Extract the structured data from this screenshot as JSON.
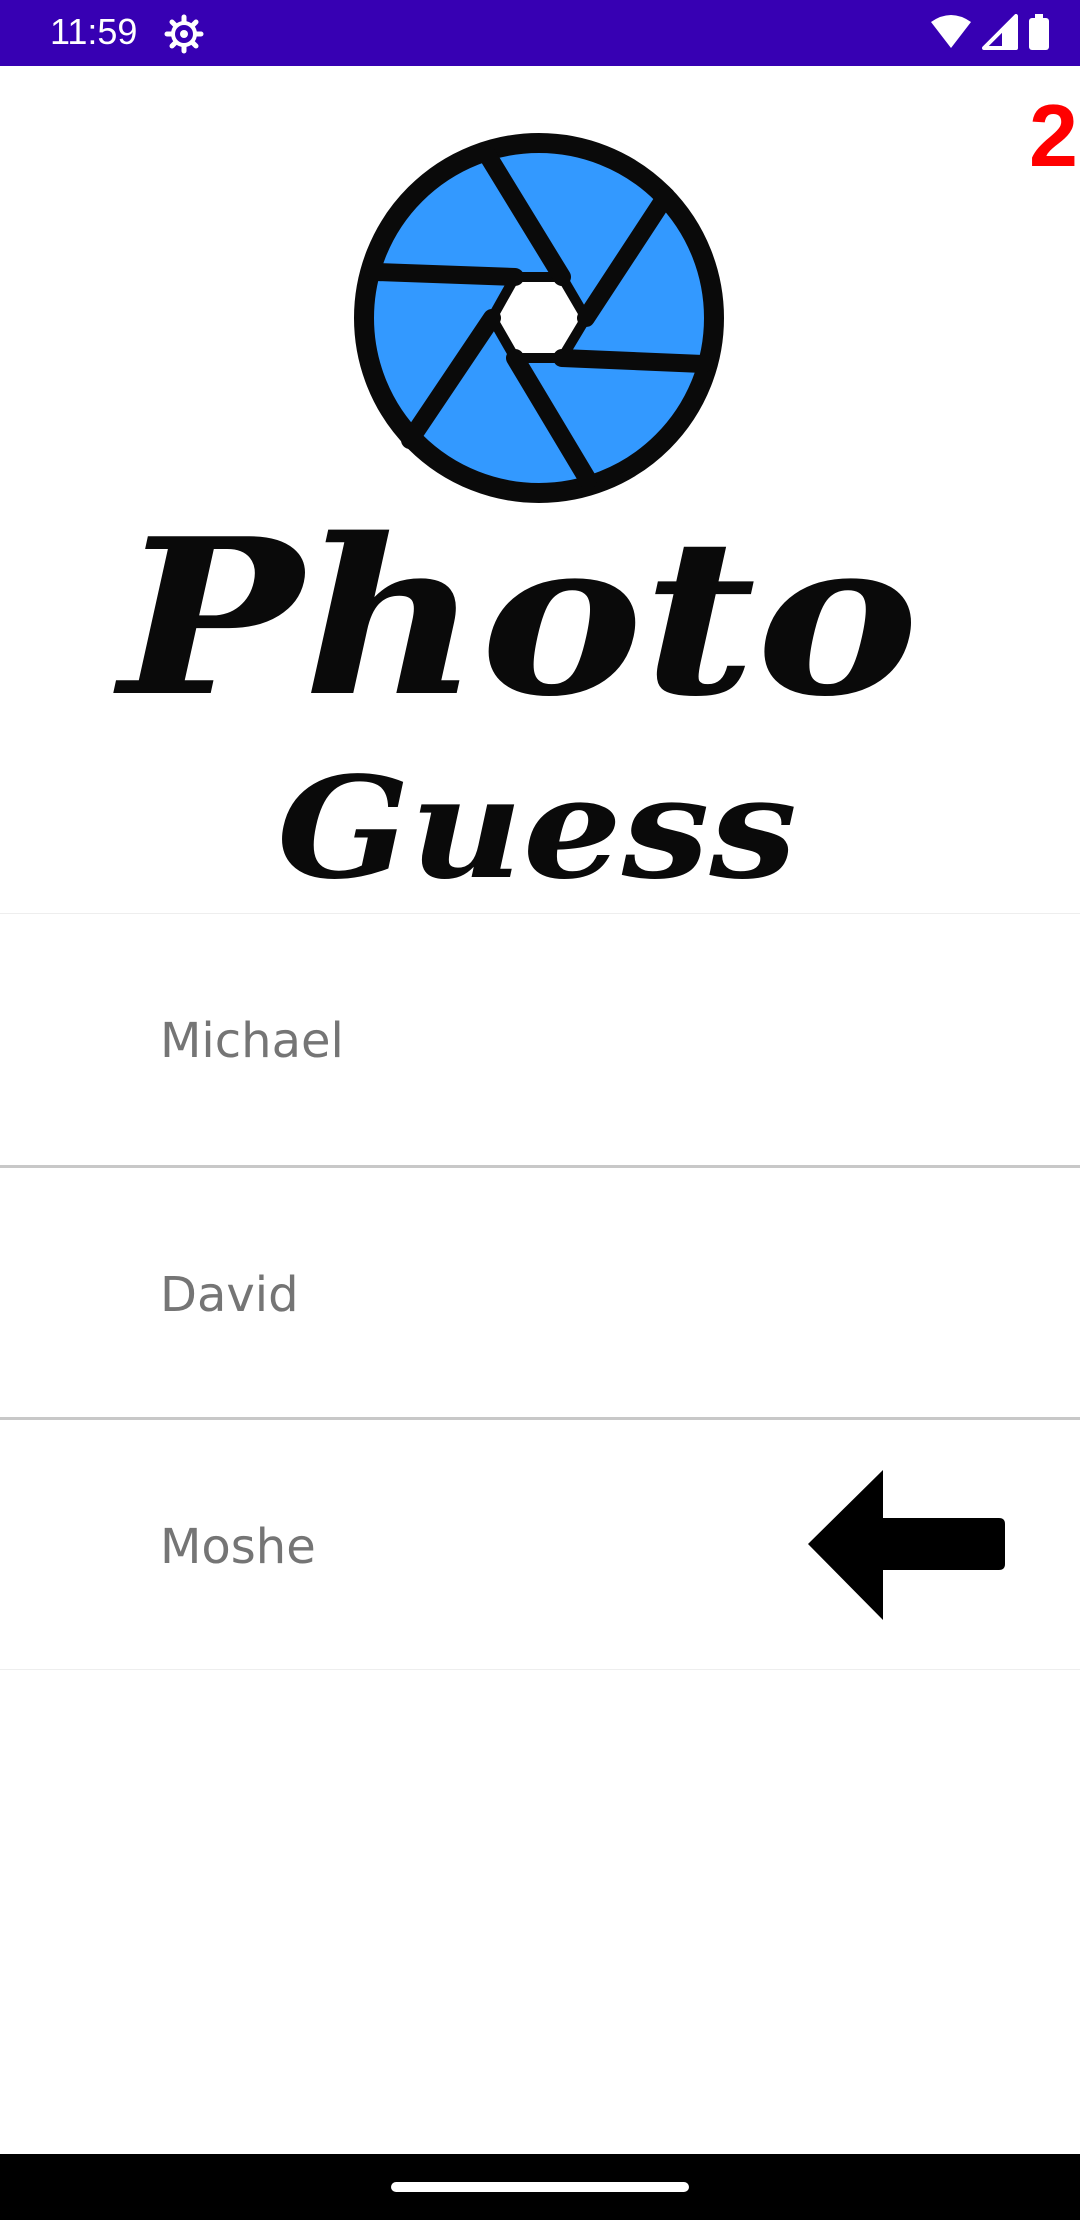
{
  "status_bar": {
    "time": "11:59",
    "background": "#3700b3",
    "icons": [
      "settings-icon",
      "wifi-icon",
      "signal-icon",
      "battery-icon"
    ]
  },
  "app": {
    "counter": "2",
    "counter_color": "#ff0000",
    "logo": {
      "line1": "Photo",
      "line2": "Guess",
      "icon": "camera-shutter-icon",
      "accent": "#3399ff"
    },
    "names": [
      {
        "label": "Michael"
      },
      {
        "label": "David"
      },
      {
        "label": "Moshe",
        "selected": true
      }
    ],
    "selection_icon": "left-arrow-icon"
  },
  "nav_bar": {
    "icon": "home-pill"
  }
}
